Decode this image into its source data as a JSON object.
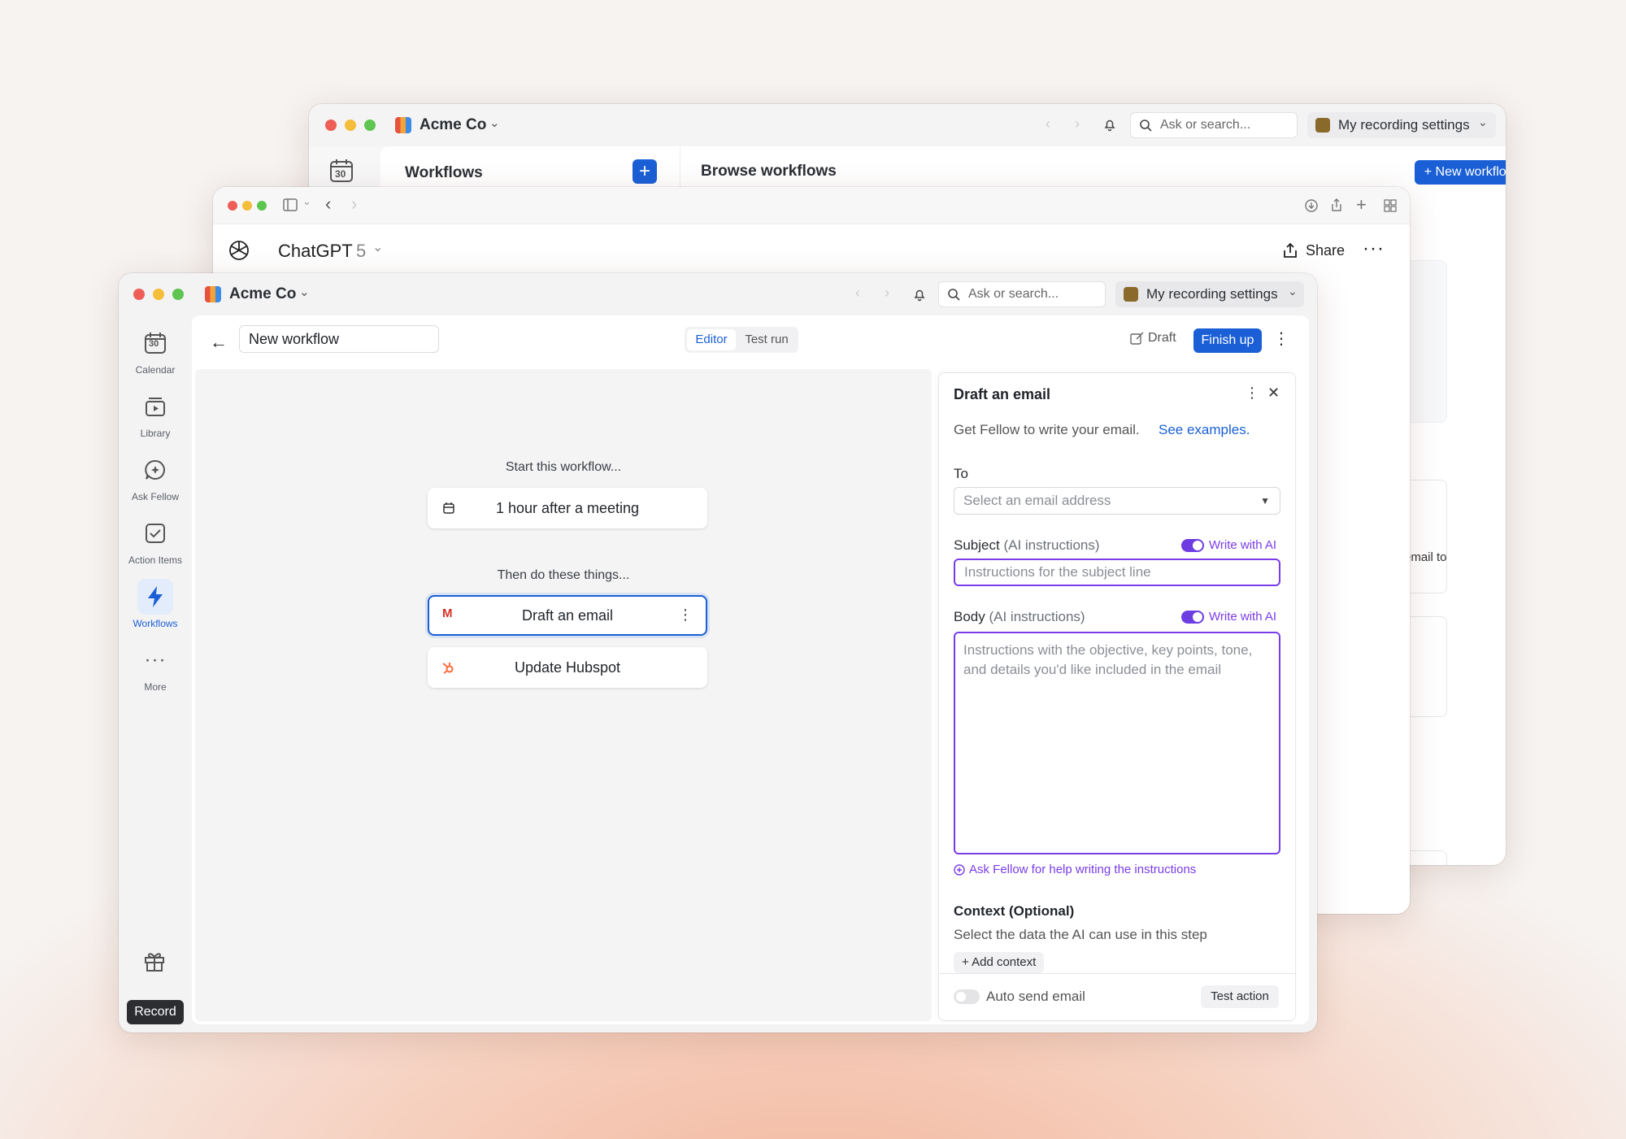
{
  "back_window": {
    "workspace": "Acme Co",
    "search_placeholder": "Ask or search...",
    "recording_settings": "My recording settings",
    "workflows_heading": "Workflows",
    "browse_heading": "Browse workflows",
    "new_workflow": "+ New workflow",
    "partial_text": "email to",
    "calendar_day": "30"
  },
  "chatgpt_window": {
    "title": "ChatGPT",
    "model": "5",
    "share": "Share"
  },
  "front_window": {
    "workspace": "Acme Co",
    "search_placeholder": "Ask or search...",
    "recording_settings": "My recording settings",
    "sidebar": {
      "calendar_day": "30",
      "items": [
        {
          "label": "Calendar"
        },
        {
          "label": "Library"
        },
        {
          "label": "Ask Fellow"
        },
        {
          "label": "Action Items"
        },
        {
          "label": "Workflows"
        },
        {
          "label": "More"
        }
      ],
      "record": "Record"
    },
    "toolbar": {
      "workflow_name": "New workflow",
      "tabs": [
        {
          "label": "Editor"
        },
        {
          "label": "Test run"
        }
      ],
      "draft": "Draft",
      "finish_up": "Finish up"
    },
    "canvas": {
      "start_label": "Start this workflow...",
      "trigger": "1 hour after a meeting",
      "then_label": "Then do these things...",
      "actions": [
        {
          "label": "Draft an email"
        },
        {
          "label": "Update Hubspot"
        }
      ]
    },
    "panel": {
      "title": "Draft an email",
      "description": "Get Fellow to write your email.",
      "see_examples": "See examples.",
      "to_label": "To",
      "to_placeholder": "Select an email address",
      "subject_label": "Subject",
      "subject_hint": "(AI instructions)",
      "write_with_ai": "Write with AI",
      "subject_placeholder": "Instructions for the subject line",
      "body_label": "Body",
      "body_hint": "(AI instructions)",
      "body_placeholder": "Instructions with the objective, key points, tone, and details you'd like included in the email",
      "ask_fellow_help": "Ask Fellow for help writing the instructions",
      "context_title": "Context (Optional)",
      "context_desc": "Select the data the AI can use in this step",
      "add_context": "+ Add context",
      "auto_send": "Auto send email",
      "test_action": "Test action"
    }
  }
}
